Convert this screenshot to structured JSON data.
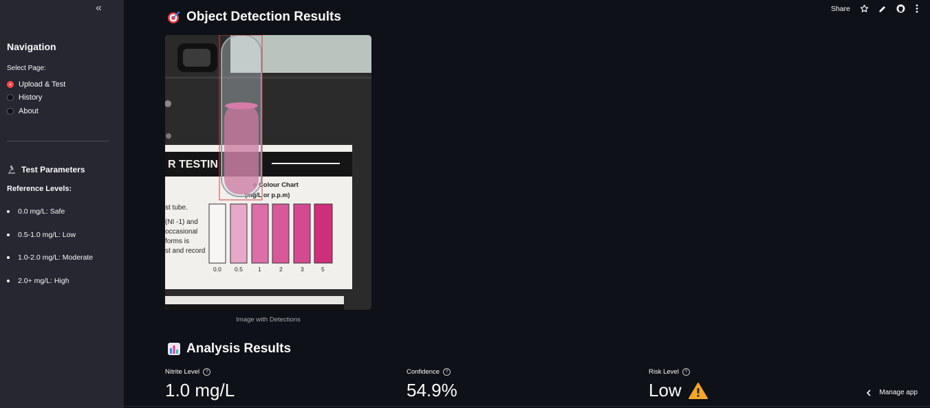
{
  "sidebar": {
    "collapse_icon": "«",
    "nav_title": "Navigation",
    "select_label": "Select Page:",
    "pages": [
      {
        "label": "Upload & Test",
        "selected": true
      },
      {
        "label": "History",
        "selected": false
      },
      {
        "label": "About",
        "selected": false
      }
    ],
    "params_title": "Test Parameters",
    "params_icon": "microscope-icon",
    "ref_title": "Reference Levels:",
    "ref_levels": [
      "0.0 mg/L: Safe",
      "0.5-1.0 mg/L: Low",
      "1.0-2.0 mg/L: Moderate",
      "2.0+ mg/L: High"
    ]
  },
  "toolbar": {
    "share_label": "Share",
    "icons": [
      "star-icon",
      "pencil-icon",
      "github-icon",
      "more-vertical-icon"
    ]
  },
  "main": {
    "detection_title": "Object Detection Results",
    "detection_icon": "dart-target-icon",
    "image_caption": "Image with Detections",
    "image_text": {
      "testing_line": "R TESTIN",
      "chart_title_1": "e Colour Chart",
      "chart_title_2": "(mg/L or p.p.m)",
      "side_texts": [
        "st tube.",
        "(NI -1) and",
        "occasional",
        "forms is",
        "st and record"
      ],
      "chart_levels": [
        "0.0",
        "0.5",
        "1",
        "2",
        "3",
        "5"
      ]
    },
    "analysis_title": "Analysis Results",
    "analysis_icon": "bar-chart-icon",
    "metrics": [
      {
        "label": "Nitrite Level",
        "value": "1.0 mg/L"
      },
      {
        "label": "Confidence",
        "value": "54.9%"
      },
      {
        "label": "Risk Level",
        "value": "Low"
      }
    ],
    "risk_icon": "warning-icon"
  },
  "footer": {
    "manage_label": "Manage app"
  },
  "colors": {
    "accent": "#ff4b4b",
    "background": "#0e1117",
    "sidebar": "#262730"
  }
}
